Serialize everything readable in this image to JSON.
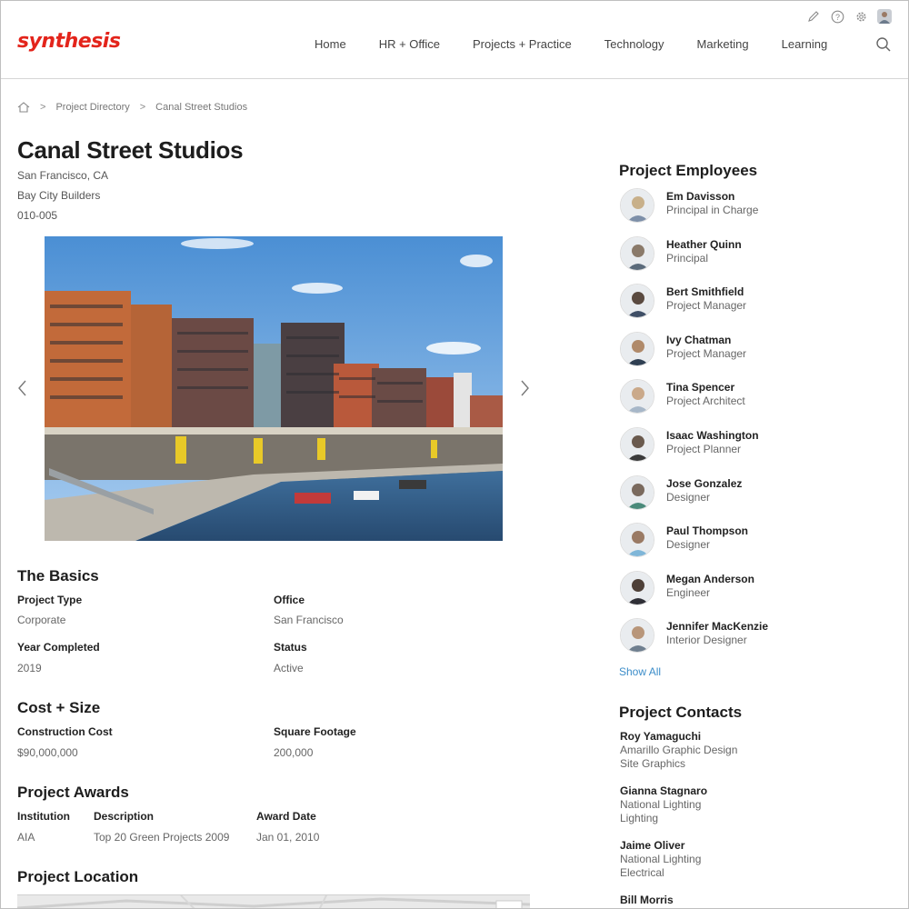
{
  "header": {
    "logo": "synthesis",
    "nav": [
      "Home",
      "HR + Office",
      "Projects + Practice",
      "Technology",
      "Marketing",
      "Learning"
    ],
    "utility_icons": [
      "pencil-icon",
      "help-icon",
      "gear-icon",
      "user-avatar"
    ]
  },
  "breadcrumb": {
    "home_icon": "home-icon",
    "separator": ">",
    "items": [
      "Project Directory",
      "Canal Street Studios"
    ]
  },
  "project": {
    "title": "Canal Street Studios",
    "location": "San Francisco, CA",
    "client": "Bay City Builders",
    "number": "010-005"
  },
  "basics": {
    "heading": "The Basics",
    "project_type_label": "Project Type",
    "project_type": "Corporate",
    "office_label": "Office",
    "office": "San Francisco",
    "year_label": "Year Completed",
    "year": "2019",
    "status_label": "Status",
    "status": "Active"
  },
  "cost": {
    "heading": "Cost + Size",
    "construction_label": "Construction Cost",
    "construction": "$90,000,000",
    "sqft_label": "Square Footage",
    "sqft": "200,000"
  },
  "awards": {
    "heading": "Project Awards",
    "columns": [
      "Institution",
      "Description",
      "Award Date"
    ],
    "rows": [
      [
        "AIA",
        "Top 20 Green Projects 2009",
        "Jan 01, 2010"
      ]
    ]
  },
  "location": {
    "heading": "Project Location"
  },
  "employees": {
    "heading": "Project Employees",
    "show_all": "Show All",
    "items": [
      {
        "name": "Em Davisson",
        "role": "Principal in Charge"
      },
      {
        "name": "Heather Quinn",
        "role": "Principal"
      },
      {
        "name": "Bert Smithfield",
        "role": "Project Manager"
      },
      {
        "name": "Ivy Chatman",
        "role": "Project Manager"
      },
      {
        "name": "Tina Spencer",
        "role": "Project Architect"
      },
      {
        "name": "Isaac Washington",
        "role": "Project Planner"
      },
      {
        "name": "Jose Gonzalez",
        "role": "Designer"
      },
      {
        "name": "Paul Thompson",
        "role": "Designer"
      },
      {
        "name": "Megan Anderson",
        "role": "Engineer"
      },
      {
        "name": "Jennifer MacKenzie",
        "role": "Interior Designer"
      }
    ]
  },
  "contacts": {
    "heading": "Project Contacts",
    "items": [
      {
        "name": "Roy Yamaguchi",
        "company": "Amarillo Graphic Design",
        "specialty": "Site Graphics"
      },
      {
        "name": "Gianna Stagnaro",
        "company": "National Lighting",
        "specialty": "Lighting"
      },
      {
        "name": "Jaime Oliver",
        "company": "National Lighting",
        "specialty": "Electrical"
      },
      {
        "name": "Bill Morris",
        "company": "",
        "specialty": ""
      }
    ]
  },
  "colors": {
    "brand": "#e3241b",
    "link": "#3c8dc9"
  }
}
